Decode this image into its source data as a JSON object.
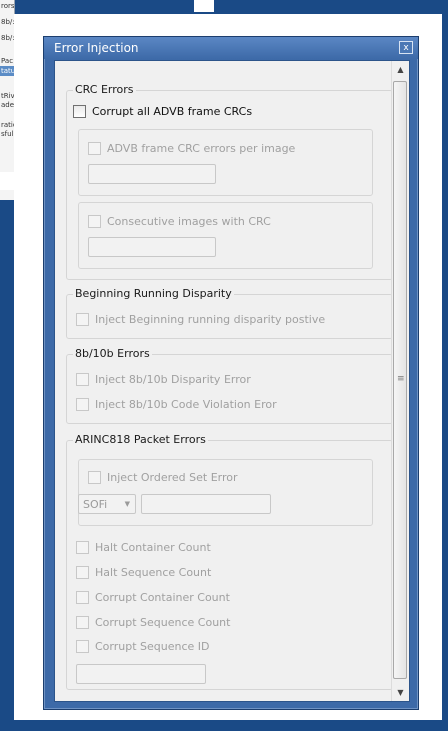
{
  "background_app": {
    "lines": [
      "rors",
      "8b/:",
      "8b/:",
      "Pac",
      "tatu",
      "tRiv",
      "ade",
      "ratio",
      "sfull"
    ]
  },
  "window": {
    "title": "Error Injection",
    "close_glyph": "x"
  },
  "crc_errors": {
    "legend": "CRC Errors",
    "corrupt_all_label": "Corrupt all ADVB frame CRCs",
    "per_image_label": "ADVB frame CRC errors per image",
    "per_image_value": "",
    "consecutive_label": "Consecutive images with CRC",
    "consecutive_value": ""
  },
  "running_disparity": {
    "legend": "Beginning Running Disparity",
    "inject_label": "Inject Beginning running disparity postive"
  },
  "errors_8b10b": {
    "legend": "8b/10b Errors",
    "disparity_label": "Inject 8b/10b Disparity Error",
    "code_violation_label": "Inject 8b/10b Code Violation Eror"
  },
  "arinc_packet_errors": {
    "legend": "ARINC818 Packet Errors",
    "ordered_set_label": "Inject Ordered Set Error",
    "ordered_set_selected": "SOFi",
    "ordered_set_value": "",
    "halt_container_label": "Halt Container Count",
    "halt_sequence_label": "Halt Sequence Count",
    "corrupt_container_label": "Corrupt Container Count",
    "corrupt_sequence_count_label": "Corrupt Sequence Count",
    "corrupt_sequence_id_label": "Corrupt Sequence ID",
    "sequence_id_value": ""
  },
  "scrollbar": {
    "up_glyph": "▲",
    "down_glyph": "▼",
    "grip_glyph": "≡"
  }
}
